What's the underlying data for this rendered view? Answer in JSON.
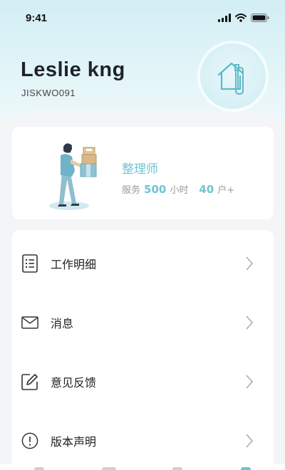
{
  "status_bar": {
    "time": "9:41",
    "icons": [
      "signal-icon",
      "wifi-icon",
      "battery-icon"
    ]
  },
  "profile": {
    "name": "Leslie kng",
    "id": "JISKWO091",
    "avatar_icon": "house-clip-icon"
  },
  "role_card": {
    "title": "整理师",
    "service_label": "服务",
    "hours_value": "500",
    "hours_unit": "小时",
    "households_value": "40",
    "households_unit": "户+",
    "illustration": "person-carrying-boxes-illustration"
  },
  "menu": {
    "items": [
      {
        "label": "工作明细",
        "icon": "list-icon"
      },
      {
        "label": "消息",
        "icon": "envelope-icon"
      },
      {
        "label": "意见反馈",
        "icon": "edit-icon"
      },
      {
        "label": "版本声明",
        "icon": "info-icon"
      }
    ]
  },
  "colors": {
    "accent": "#6fc5d3",
    "header_bg": "#d2eef4",
    "page_bg": "#f4f5f6"
  }
}
